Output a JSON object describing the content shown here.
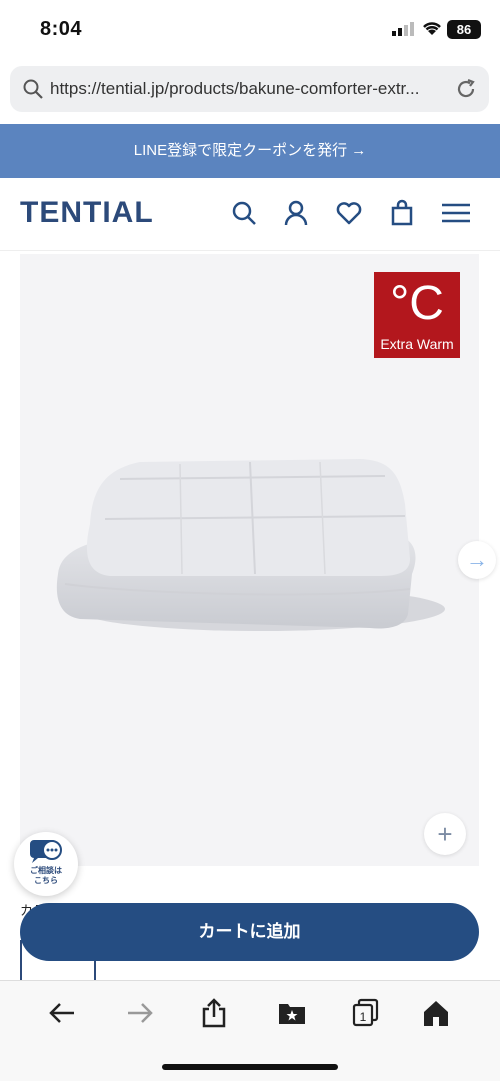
{
  "status_bar": {
    "time": "8:04",
    "battery": "86"
  },
  "browser": {
    "url": "https://tential.jp/products/bakune-comforter-extr..."
  },
  "promo": {
    "text": "LINE登録で限定クーポンを発行 →"
  },
  "header": {
    "logo": "TENTIAL"
  },
  "product": {
    "badge_symbol": "°C",
    "badge_text": "Extra Warm",
    "color_label": "カラー：",
    "cart_label": "カートに追加"
  },
  "chat": {
    "label_line1": "ご相談は",
    "label_line2": "こちら"
  },
  "colors": {
    "brand": "#254d82",
    "promo": "#5b84bf",
    "badge": "#b3171d"
  },
  "icons": [
    "search-icon",
    "account-icon",
    "heart-icon",
    "bag-icon",
    "menu-icon",
    "back-icon",
    "forward-icon",
    "share-icon",
    "bookmarks-icon",
    "tabs-icon",
    "home-icon"
  ],
  "toolbar": {
    "tabs_count": "1"
  }
}
